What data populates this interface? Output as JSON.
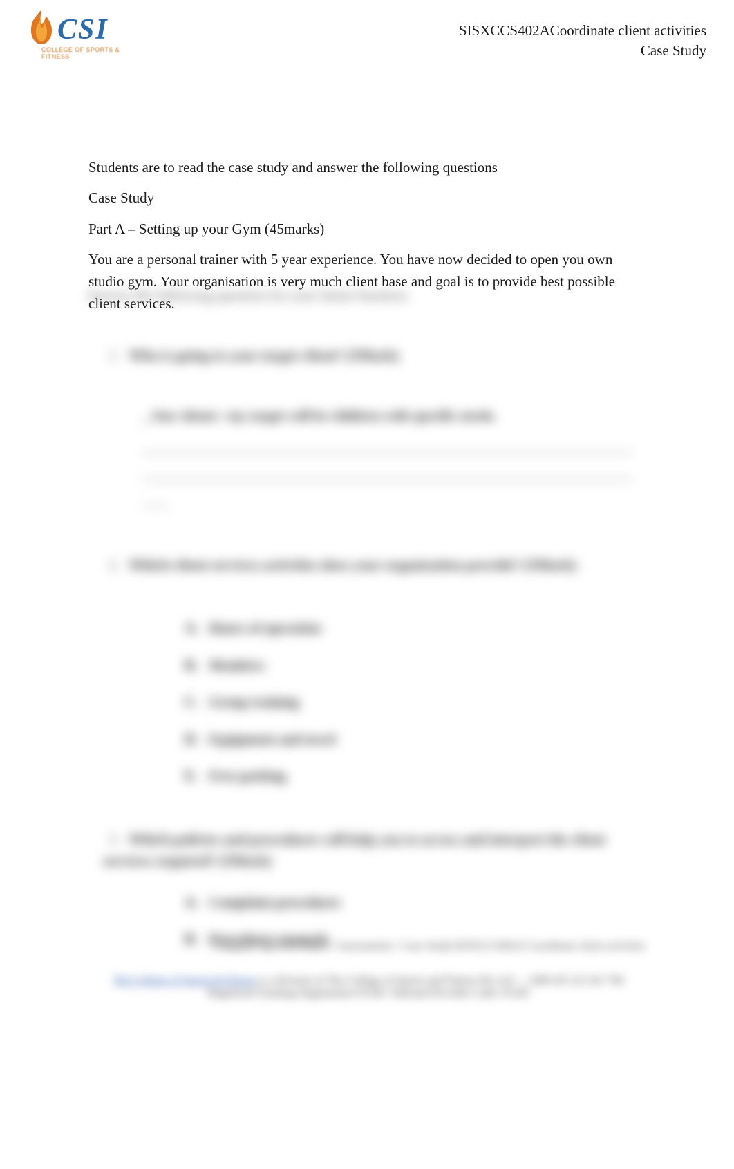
{
  "header": {
    "logo_main": "CSI",
    "logo_sub": "COLLEGE OF SPORTS & FITNESS",
    "line1": "SISXCCS402ACoordinate client activities",
    "line2": "Case Study"
  },
  "content": {
    "instruction": "Students are to read the case study and answer the following questions",
    "case_study_label": "Case Study",
    "part_a": "Part A – Setting up your Gym (45marks)",
    "body": "You are a personal trainer with 5 year experience. You have now decided to open you own studio gym. Your organisation is very much client base and goal is to provide best possible client services.",
    "body_blur": "Answer the following question for your future business"
  },
  "questions": {
    "q1": {
      "num": "1.",
      "text": "Who is going to your target client? (5Mark)",
      "answer_lead": "_ Our clients / my target will be children with specific needs."
    },
    "q2": {
      "num": "2.",
      "text": "Which client services activities does your organisation provide? (5Mark)",
      "items": [
        {
          "bullet": "A.",
          "label": "Hours of operation"
        },
        {
          "bullet": "B.",
          "label": "Members"
        },
        {
          "bullet": "C.",
          "label": "Group training"
        },
        {
          "bullet": "D.",
          "label": "Equipment and towel"
        },
        {
          "bullet": "E.",
          "label": "Free parking"
        }
      ]
    },
    "q3": {
      "num": "3.",
      "text": "Which policies and procedures will help you to access and interpret the client services required? (5Mark)",
      "items": [
        {
          "bullet": "A.",
          "label": "Complaint procedures"
        },
        {
          "bullet": "B.",
          "label": "Procedures manuals"
        }
      ]
    }
  },
  "footer": {
    "path": "Category\\ Sport & Fitness \\ Assessments \\ Case Study\\SISXCCS402A Coordinate client activities",
    "org_link": "The College of Sports & Fitness",
    "org_tail": " is a division of The College of Sports and Fitness Pty Ltd — ABN 40 123 241 766 Registered Training Organisation 91345. National Provider Code: 91345"
  }
}
